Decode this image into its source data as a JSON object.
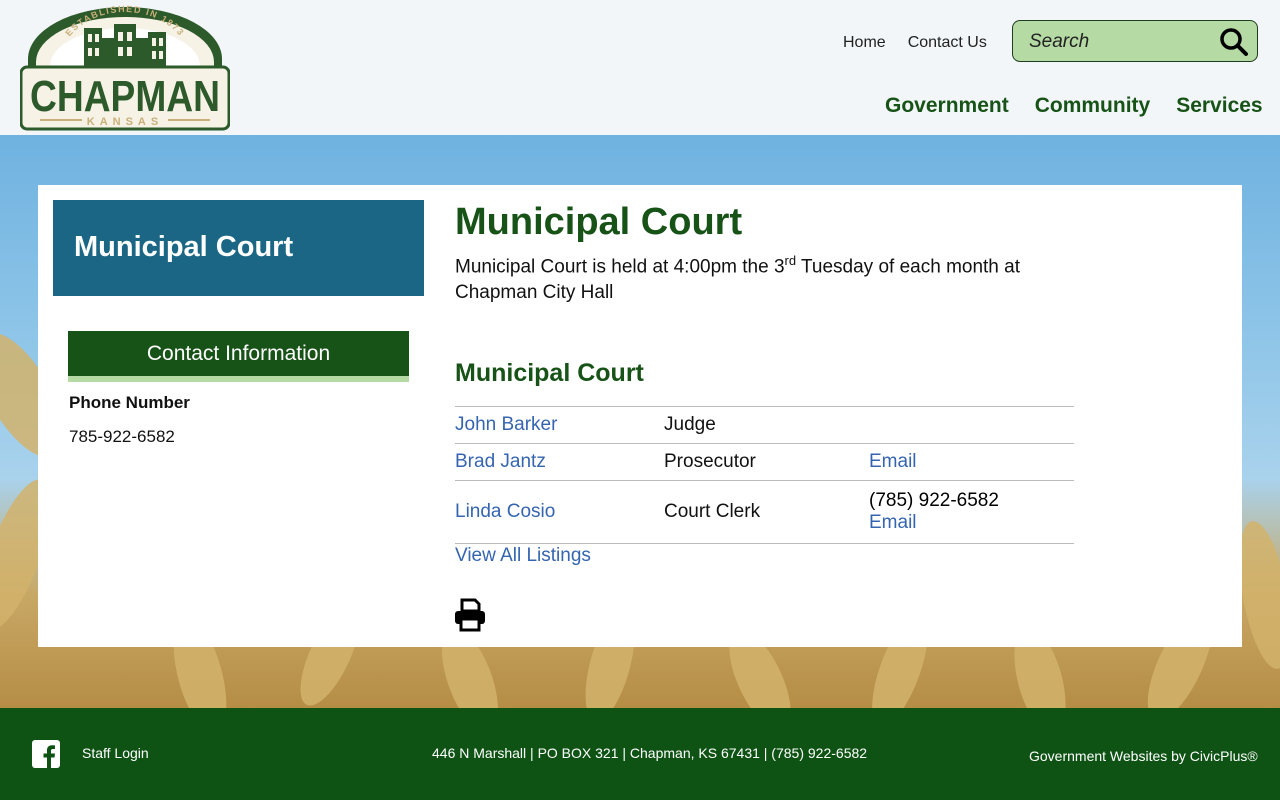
{
  "header": {
    "logo": {
      "arc_text": "ESTABLISHED IN 1873",
      "name": "CHAPMAN",
      "state": "KANSAS"
    },
    "top_links": [
      "Home",
      "Contact Us"
    ],
    "search": {
      "placeholder": "Search"
    },
    "nav": [
      "Government",
      "Community",
      "Services"
    ]
  },
  "sidebar": {
    "title": "Municipal Court",
    "contact_heading": "Contact Information",
    "phone_label": "Phone Number",
    "phone_value": "785-922-6582"
  },
  "main": {
    "title": "Municipal Court",
    "intro_before": "Municipal Court is held at 4:00pm the 3",
    "intro_sup": "rd",
    "intro_after": " Tuesday of each month at Chapman City Hall",
    "directory_title": "Municipal Court",
    "staff": [
      {
        "name": "John Barker",
        "role": "Judge",
        "phone": "",
        "email": ""
      },
      {
        "name": "Brad Jantz",
        "role": "Prosecutor",
        "phone": "",
        "email": "Email"
      },
      {
        "name": "Linda Cosio",
        "role": "Court Clerk",
        "phone": "(785) 922-6582",
        "email": "Email"
      }
    ],
    "view_all": "View All Listings"
  },
  "footer": {
    "staff_login": "Staff Login",
    "address": "446 N Marshall | PO BOX 321 | Chapman, KS 67431 | (785) 922-6582",
    "credit": "Government Websites by CivicPlus®"
  },
  "colors": {
    "brand_green": "#175217",
    "light_green": "#b6daa4",
    "sidebar_blue": "#1b6685",
    "link_blue": "#3565b0",
    "footer_green": "#0e5314"
  },
  "icons": [
    "search-icon",
    "print-icon",
    "facebook-icon"
  ]
}
